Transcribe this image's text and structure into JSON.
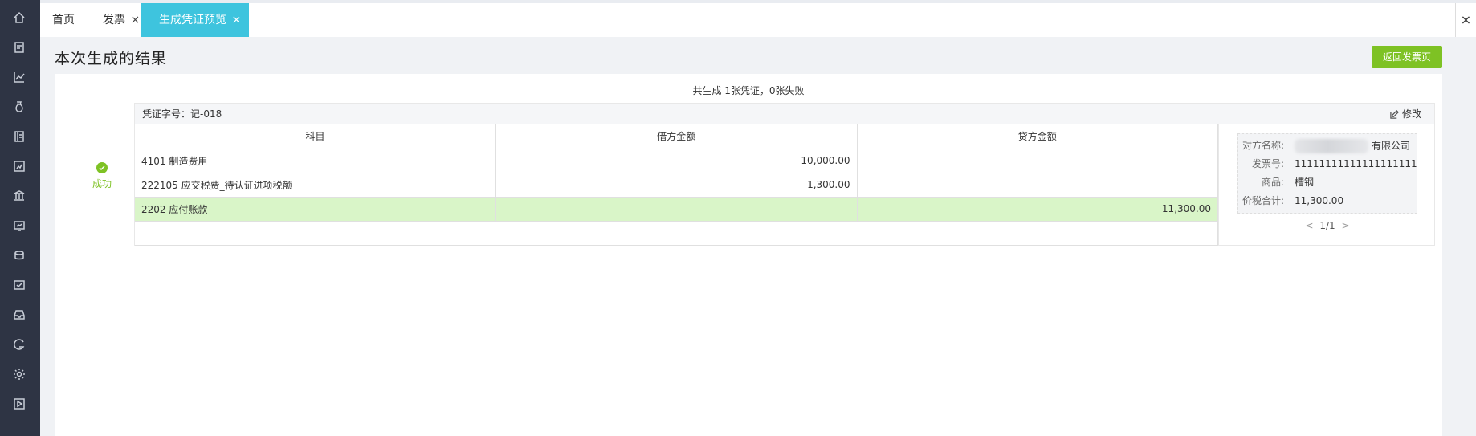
{
  "tabs": {
    "home": "首页",
    "invoice": "发票",
    "invoice_close": "×",
    "active": "生成凭证预览",
    "active_close": "×",
    "bar_close": "×"
  },
  "page": {
    "title": "本次生成的结果",
    "return_button": "返回发票页",
    "summary": "共生成 1张凭证，0张失败"
  },
  "status": {
    "label": "成功",
    "color": "#7ec224"
  },
  "voucher": {
    "number_label": "凭证字号：记-018",
    "edit_label": "修改",
    "columns": [
      "科目",
      "借方金额",
      "贷方金额"
    ],
    "rows": [
      {
        "account": "4101 制造费用",
        "debit": "10,000.00",
        "credit": ""
      },
      {
        "account": "222105 应交税费_待认证进项税额",
        "debit": "1,300.00",
        "credit": ""
      },
      {
        "account": "2202 应付账款",
        "debit": "",
        "credit": "11,300.00"
      }
    ]
  },
  "invoice": {
    "counterparty_label": "对方名称:",
    "counterparty_value": "有限公司",
    "invoice_no_label": "发票号:",
    "invoice_no_value": "11111111111111111111",
    "goods_label": "商品:",
    "goods_value": "槽钢",
    "total_label": "价税合计:",
    "total_value": "11,300.00",
    "pager": {
      "prev": "<",
      "current": "1/1",
      "next": ">"
    }
  },
  "sidebar_icons": [
    "home-icon",
    "invoice-icon",
    "chart-icon",
    "money-bag-icon",
    "ledger-icon",
    "report-icon",
    "bank-icon",
    "monitor-icon",
    "cup-icon",
    "voucher-icon",
    "inbox-icon",
    "g-icon",
    "settings-icon",
    "play-icon"
  ],
  "colors": {
    "sidebar": "#2e3444",
    "accent_tab": "#3ec4de",
    "primary_button": "#7ec224",
    "highlight_row": "#d9f5c8"
  }
}
